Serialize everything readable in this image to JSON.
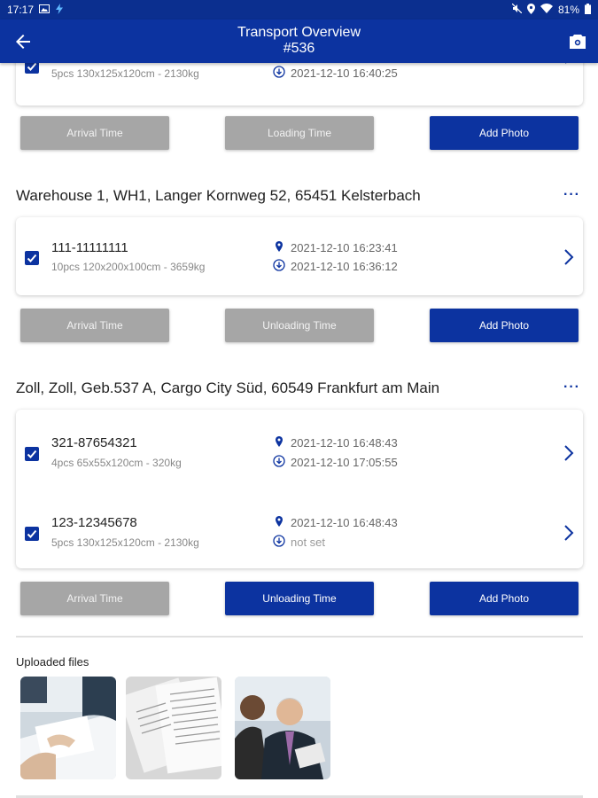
{
  "status_bar": {
    "time": "17:17",
    "battery": "81%"
  },
  "app_bar": {
    "title_line1": "Transport Overview",
    "title_line2": "#536"
  },
  "sections": [
    {
      "items": [
        {
          "desc": "5pcs 130x125x120cm - 2130kg",
          "time2": "2021-12-10 16:40:25"
        }
      ],
      "buttons": [
        "Arrival Time",
        "Loading Time",
        "Add Photo"
      ]
    },
    {
      "address": "Warehouse 1, WH1, Langer Kornweg 52, 65451 Kelsterbach",
      "more": "···",
      "items": [
        {
          "id": "111-11111111",
          "desc": "10pcs 120x200x100cm - 3659kg",
          "time1": "2021-12-10 16:23:41",
          "time2": "2021-12-10 16:36:12"
        }
      ],
      "buttons": [
        "Arrival Time",
        "Unloading Time",
        "Add Photo"
      ]
    },
    {
      "address": "Zoll, Zoll, Geb.537 A, Cargo City Süd, 60549 Frankfurt am Main",
      "more": "···",
      "items": [
        {
          "id": "321-87654321",
          "desc": "4pcs 65x55x120cm - 320kg",
          "time1": "2021-12-10 16:48:43",
          "time2": "2021-12-10 17:05:55"
        },
        {
          "id": "123-12345678",
          "desc": "5pcs 130x125x120cm - 2130kg",
          "time1": "2021-12-10 16:48:43",
          "time2": "not set"
        }
      ],
      "buttons": [
        "Arrival Time",
        "Unloading Time",
        "Add Photo"
      ]
    }
  ],
  "uploaded": {
    "label": "Uploaded files"
  },
  "colors": {
    "primary": "#0c33a0",
    "status_bar": "#0b2f8f",
    "disabled": "#a6a6a6"
  }
}
